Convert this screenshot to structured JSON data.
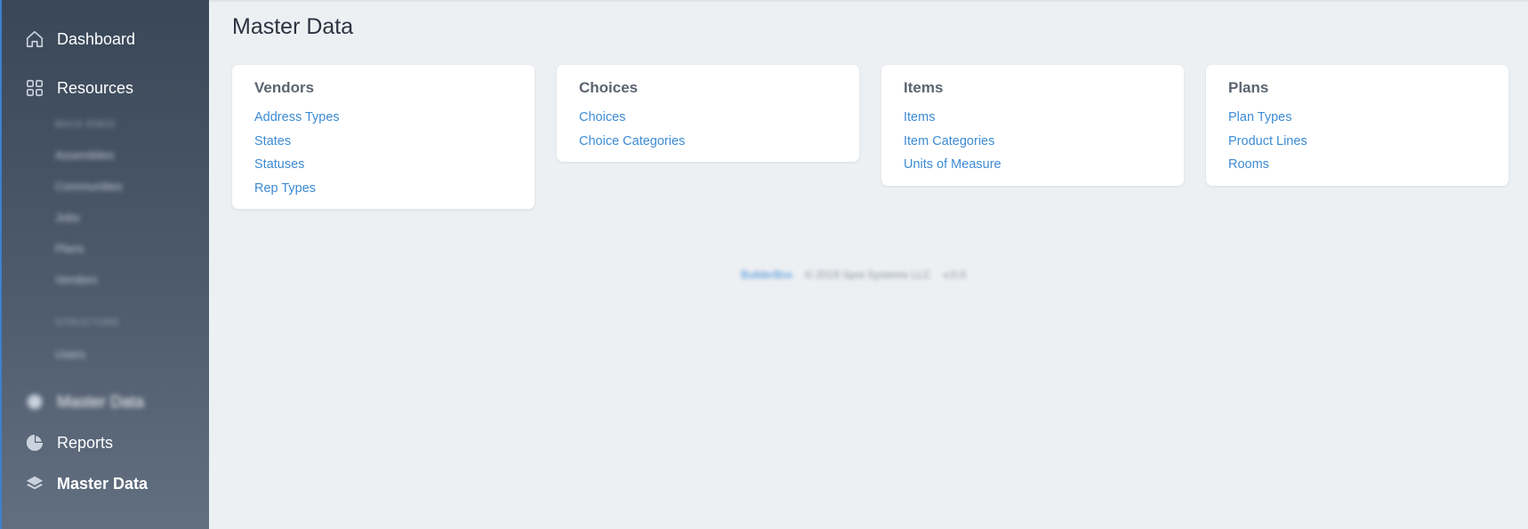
{
  "sidebar": {
    "items": [
      {
        "label": "Dashboard",
        "icon": "home-icon"
      },
      {
        "label": "Resources",
        "icon": "grid-icon"
      },
      {
        "label": "Master Data",
        "icon": "database-icon"
      },
      {
        "label": "Reports",
        "icon": "pie-chart-icon"
      },
      {
        "label": "Master Data",
        "icon": "layers-icon"
      }
    ],
    "resources_sub": {
      "section_one_header": "BACK ENDS",
      "section_one_items": [
        "Assemblies",
        "Communities",
        "Jobs",
        "Plans",
        "Vendors"
      ],
      "section_two_header": "STRUCTURE",
      "section_two_items": [
        "Users"
      ]
    }
  },
  "main": {
    "title": "Master Data",
    "cards": [
      {
        "title": "Vendors",
        "links": [
          "Address Types",
          "States",
          "Statuses",
          "Rep Types"
        ]
      },
      {
        "title": "Choices",
        "links": [
          "Choices",
          "Choice Categories"
        ]
      },
      {
        "title": "Items",
        "links": [
          "Items",
          "Item Categories",
          "Units of Measure"
        ]
      },
      {
        "title": "Plans",
        "links": [
          "Plan Types",
          "Product Lines",
          "Rooms"
        ]
      }
    ]
  },
  "footer": {
    "link": "BuilderBox",
    "copyright": "© 2019 Spot Systems LLC",
    "version": "v.0.0"
  },
  "colors": {
    "sidebar_top": "#3a4758",
    "sidebar_bottom": "#626f81",
    "accent_link": "#3d8bd4",
    "page_bg": "#edf0f3"
  }
}
